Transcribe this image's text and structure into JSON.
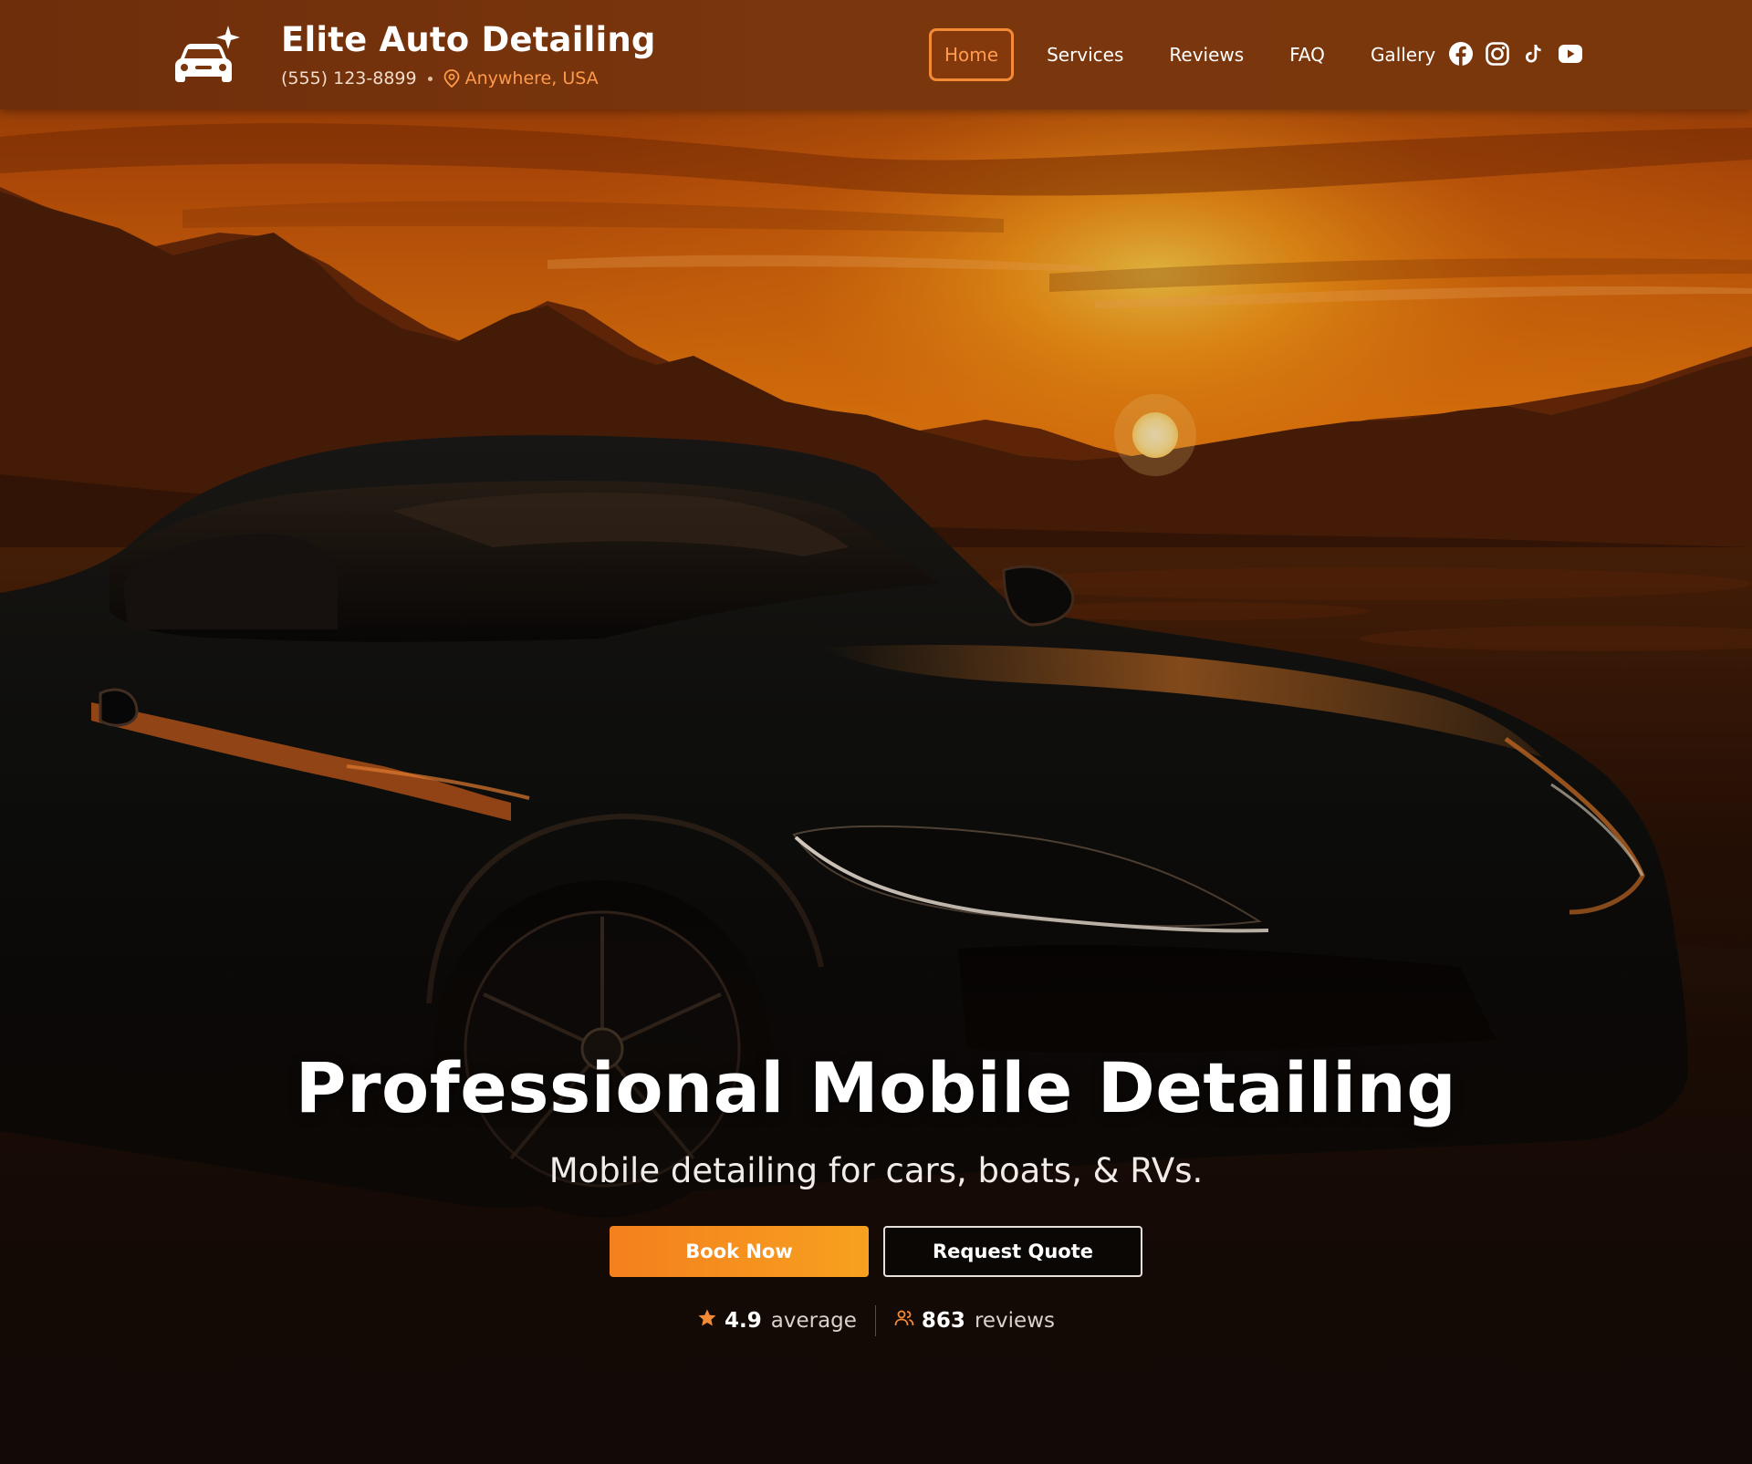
{
  "header": {
    "brand_title": "Elite Auto Detailing",
    "phone": "(555) 123-8899",
    "location": "Anywhere, USA",
    "logo_icon": "car-sparkle-icon"
  },
  "nav": {
    "items": [
      {
        "label": "Home",
        "active": true
      },
      {
        "label": "Services",
        "active": false
      },
      {
        "label": "Reviews",
        "active": false
      },
      {
        "label": "FAQ",
        "active": false
      },
      {
        "label": "Gallery",
        "active": false
      }
    ]
  },
  "socials": [
    "facebook-icon",
    "instagram-icon",
    "tiktok-icon",
    "youtube-icon"
  ],
  "hero": {
    "title": "Professional Mobile Detailing",
    "subtitle": "Mobile detailing for cars, boats, & RVs.",
    "primary_cta": "Book Now",
    "secondary_cta": "Request Quote",
    "rating": {
      "value": "4.9",
      "label": "average"
    },
    "reviews": {
      "value": "863",
      "label": "reviews"
    }
  },
  "colors": {
    "accent": "#f58a36",
    "header_bg": "#7a360c",
    "button_gradient_start": "#f47f1e",
    "button_gradient_end": "#f7a11f",
    "location_text": "#ff9a4a"
  }
}
